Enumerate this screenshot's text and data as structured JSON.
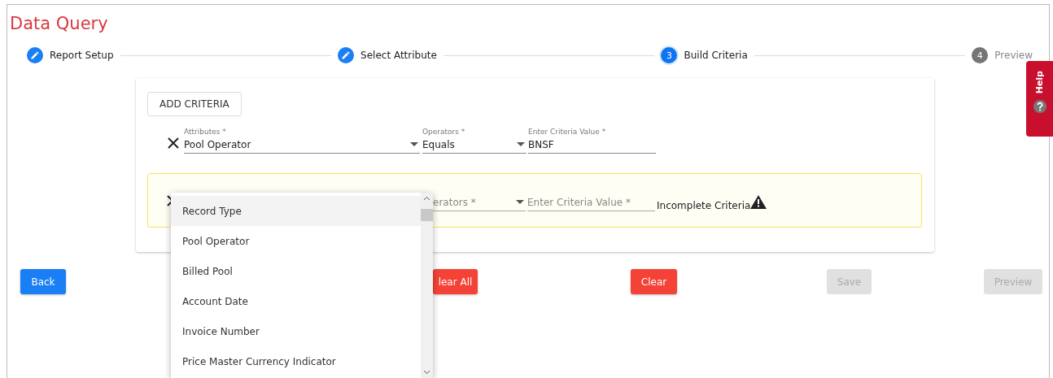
{
  "title": "Data Query",
  "steps": [
    {
      "label": "Report Setup",
      "completed": true,
      "selected": false
    },
    {
      "label": "Select Attribute",
      "completed": true,
      "selected": false
    },
    {
      "number": "3",
      "label": "Build Criteria",
      "completed": false,
      "selected": true
    },
    {
      "number": "4",
      "label": "Preview",
      "completed": false,
      "selected": false
    }
  ],
  "help": {
    "label": "Help"
  },
  "add_button": "ADD CRITERIA",
  "criteria": [
    {
      "attribute": {
        "label": "Attributes *",
        "value": "Pool Operator"
      },
      "operator": {
        "label": "Operators *",
        "value": "Equals"
      },
      "value_field": {
        "label": "Enter Criteria Value *",
        "value": "BNSF"
      },
      "incomplete": false
    },
    {
      "operator": {
        "placeholder": "erators *"
      },
      "value_field": {
        "placeholder": "Enter Criteria Value *"
      },
      "incomplete": true,
      "warning": "Incomplete Criteria"
    }
  ],
  "dropdown": {
    "options": [
      {
        "label": "Record Type",
        "selected": true
      },
      {
        "label": "Pool Operator",
        "selected": false
      },
      {
        "label": "Billed Pool",
        "selected": false
      },
      {
        "label": "Account Date",
        "selected": false
      },
      {
        "label": "Invoice Number",
        "selected": false
      },
      {
        "label": "Price Master Currency Indicator",
        "selected": false
      }
    ]
  },
  "buttons": [
    {
      "label": "Back",
      "kind": "primary",
      "disabled": false
    },
    {
      "label": "lear All",
      "kind": "danger",
      "disabled": false
    },
    {
      "label": "Clear",
      "kind": "danger",
      "disabled": false
    },
    {
      "label": "Save",
      "kind": "primary",
      "disabled": true
    },
    {
      "label": "Preview",
      "kind": "primary",
      "disabled": true
    }
  ]
}
